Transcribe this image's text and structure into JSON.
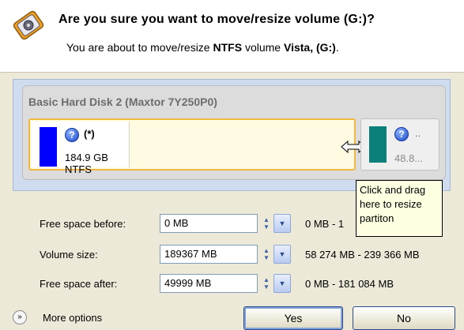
{
  "header": {
    "title": "Are you sure you want to move/resize volume (G:)?",
    "subtitle_prefix": "You are about to move/resize ",
    "subtitle_fs": "NTFS",
    "subtitle_mid": " volume ",
    "subtitle_volume": "Vista, (G:)",
    "subtitle_suffix": ".",
    "icon": "disk-resize-icon"
  },
  "disk": {
    "title": "Basic Hard Disk 2 (Maxtor 7Y250P0)",
    "partitions": [
      {
        "label": "(*)",
        "info": "184.9 GB NTFS",
        "color": "#0000ff",
        "icon": "help-icon"
      },
      {
        "label": "..",
        "info": "48.8...",
        "color": "#0b7f7a",
        "icon": "help-icon"
      }
    ]
  },
  "tooltip": {
    "lines": [
      "Click and drag",
      "here to resize",
      "partiton"
    ]
  },
  "fields": [
    {
      "label": "Free space before:",
      "value": "0 MB",
      "range": "0 MB - 1"
    },
    {
      "label": "Volume size:",
      "value": "189367 MB",
      "range": "58 274 MB - 239 366 MB"
    },
    {
      "label": "Free space after:",
      "value": "49999 MB",
      "range": "0 MB - 181 084 MB"
    }
  ],
  "footer": {
    "more_options": "More options",
    "yes": "Yes",
    "no": "No"
  },
  "colors": {
    "accent": "#f0b840",
    "selection_border": "#2d4a8c"
  }
}
